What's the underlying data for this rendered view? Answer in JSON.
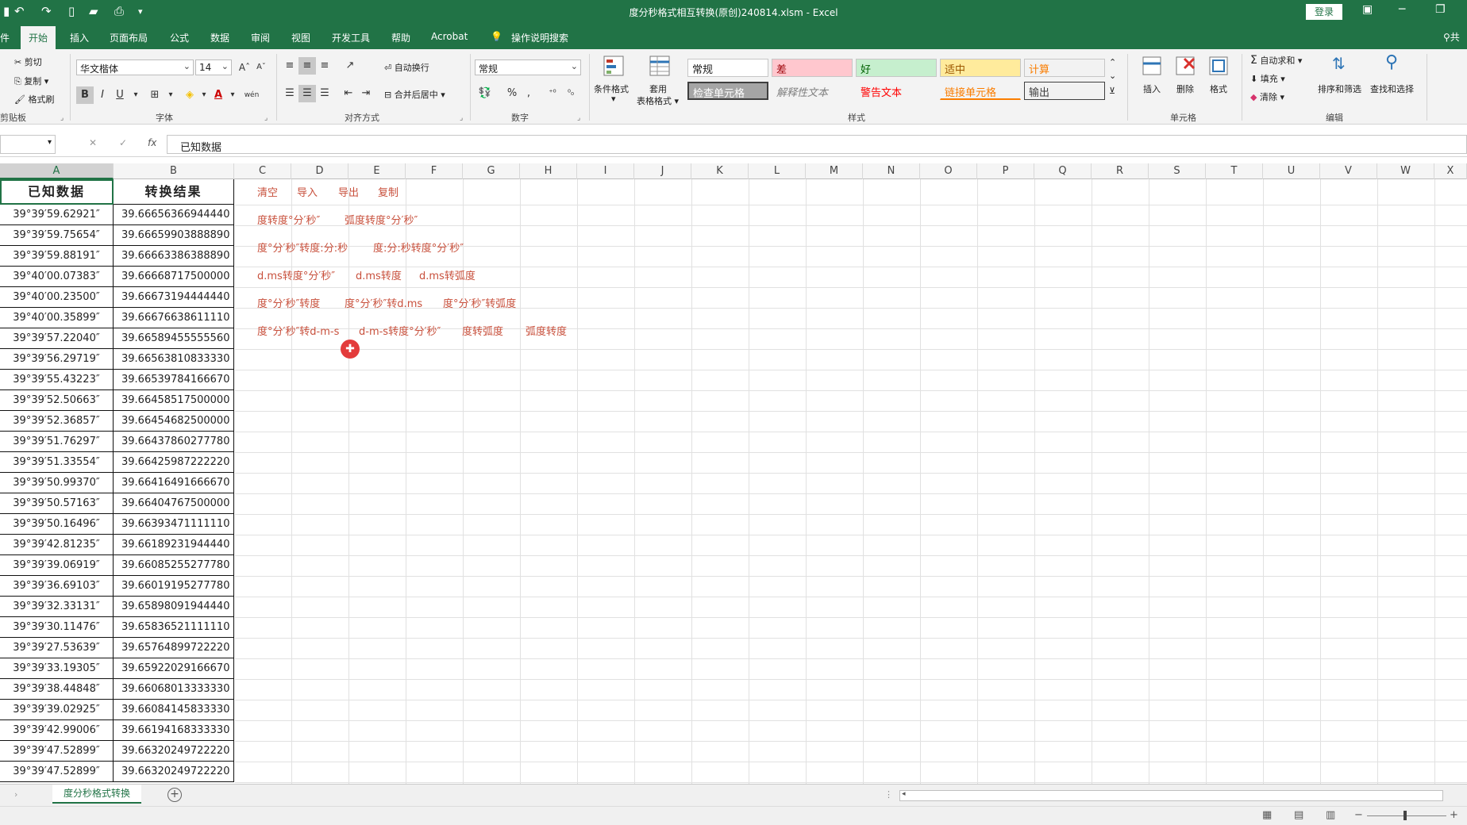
{
  "title_bar": {
    "title": "度分秒格式相互转换(原创)240814.xlsm  -  Excel",
    "login_label": "登录",
    "icons": [
      "undo-icon",
      "redo-icon",
      "new-file-icon",
      "open-folder-icon",
      "print-preview-icon",
      "customize-qat-icon"
    ]
  },
  "tabs": [
    {
      "label": "件"
    },
    {
      "label": "开始"
    },
    {
      "label": "插入"
    },
    {
      "label": "页面布局"
    },
    {
      "label": "公式"
    },
    {
      "label": "数据"
    },
    {
      "label": "审阅"
    },
    {
      "label": "视图"
    },
    {
      "label": "开发工具"
    },
    {
      "label": "帮助"
    },
    {
      "label": "Acrobat"
    },
    {
      "label": "操作说明搜索"
    }
  ],
  "share_label": "共",
  "ribbon": {
    "clipboard": {
      "cut": "剪切",
      "copy": "复制",
      "format_painter": "格式刷",
      "group": "剪贴板"
    },
    "font": {
      "name": "华文楷体",
      "size": "14",
      "bold": "B",
      "italic": "I",
      "underline": "U",
      "grow": "A",
      "shrink": "A",
      "font_color": "A",
      "phonetic": "wén",
      "group": "字体"
    },
    "alignment": {
      "wrap": "自动换行",
      "merge": "合并后居中",
      "group": "对齐方式"
    },
    "number": {
      "format": "常规",
      "percent": "%",
      "comma": ",",
      "group": "数字"
    },
    "styles": {
      "conditional": "条件格式",
      "table_format_1": "套用",
      "table_format_2": "表格格式",
      "cells": [
        {
          "label": "常规",
          "bg": "#ffffff",
          "fg": "#222222"
        },
        {
          "label": "差",
          "bg": "#ffc7ce",
          "fg": "#9c0006"
        },
        {
          "label": "好",
          "bg": "#c6efce",
          "fg": "#006100"
        },
        {
          "label": "适中",
          "bg": "#ffeb9c",
          "fg": "#9c5700"
        },
        {
          "label": "计算",
          "bg": "#f2f2f2",
          "fg": "#fa7d00"
        },
        {
          "label": "检查单元格",
          "bg": "#a5a5a5",
          "fg": "#ffffff"
        },
        {
          "label": "解释性文本",
          "bg": "#f3f3f3",
          "fg": "#7f7f7f"
        },
        {
          "label": "警告文本",
          "bg": "#f3f3f3",
          "fg": "#ff0000"
        },
        {
          "label": "链接单元格",
          "bg": "#f3f3f3",
          "fg": "#fa7d00"
        },
        {
          "label": "输出",
          "bg": "#f2f2f2",
          "fg": "#3f3f3f"
        }
      ],
      "group": "样式"
    },
    "cells_group": {
      "insert": "插入",
      "delete": "删除",
      "format": "格式",
      "group": "单元格"
    },
    "editing": {
      "autosum": "自动求和",
      "fill": "填充",
      "clear": "清除",
      "sort": "排序和筛选",
      "find": "查找和选择",
      "group": "编辑"
    }
  },
  "formula_bar": {
    "fx": "fx",
    "value": "已知数据"
  },
  "columns": [
    "A",
    "B",
    "C",
    "D",
    "E",
    "F",
    "G",
    "H",
    "I",
    "J",
    "K",
    "L",
    "M",
    "N",
    "O",
    "P",
    "Q",
    "R",
    "S",
    "T",
    "U",
    "V",
    "W",
    "X"
  ],
  "sheet": {
    "header_a": "已知数据",
    "header_b": "转换结果",
    "rows": [
      {
        "a": "39°39′59.62921″",
        "b": "39.66656366944440"
      },
      {
        "a": "39°39′59.75654″",
        "b": "39.66659903888890"
      },
      {
        "a": "39°39′59.88191″",
        "b": "39.66663386388890"
      },
      {
        "a": "39°40′00.07383″",
        "b": "39.66668717500000"
      },
      {
        "a": "39°40′00.23500″",
        "b": "39.66673194444440"
      },
      {
        "a": "39°40′00.35899″",
        "b": "39.66676638611110"
      },
      {
        "a": "39°39′57.22040″",
        "b": "39.66589455555560"
      },
      {
        "a": "39°39′56.29719″",
        "b": "39.66563810833330"
      },
      {
        "a": "39°39′55.43223″",
        "b": "39.66539784166670"
      },
      {
        "a": "39°39′52.50663″",
        "b": "39.66458517500000"
      },
      {
        "a": "39°39′52.36857″",
        "b": "39.66454682500000"
      },
      {
        "a": "39°39′51.76297″",
        "b": "39.66437860277780"
      },
      {
        "a": "39°39′51.33554″",
        "b": "39.66425987222220"
      },
      {
        "a": "39°39′50.99370″",
        "b": "39.66416491666670"
      },
      {
        "a": "39°39′50.57163″",
        "b": "39.66404767500000"
      },
      {
        "a": "39°39′50.16496″",
        "b": "39.66393471111110"
      },
      {
        "a": "39°39′42.81235″",
        "b": "39.66189231944440"
      },
      {
        "a": "39°39′39.06919″",
        "b": "39.66085255277780"
      },
      {
        "a": "39°39′36.69103″",
        "b": "39.66019195277780"
      },
      {
        "a": "39°39′32.33131″",
        "b": "39.65898091944440"
      },
      {
        "a": "39°39′30.11476″",
        "b": "39.65836521111110"
      },
      {
        "a": "39°39′27.53639″",
        "b": "39.65764899722220"
      },
      {
        "a": "39°39′33.19305″",
        "b": "39.65922029166670"
      },
      {
        "a": "39°39′38.44848″",
        "b": "39.66068013333330"
      },
      {
        "a": "39°39′39.02925″",
        "b": "39.66084145833330"
      },
      {
        "a": "39°39′42.99006″",
        "b": "39.66194168333330"
      },
      {
        "a": "39°39′47.52899″",
        "b": "39.66320249722220"
      },
      {
        "a": "39°39′47.52899″",
        "b": "39.66320249722220"
      }
    ]
  },
  "macro_buttons": [
    [
      "清空",
      "导入",
      "导出",
      "复制"
    ],
    [
      "度转度°分′秒″",
      "弧度转度°分′秒″"
    ],
    [
      "度°分′秒″转度:分:秒",
      "度:分:秒转度°分′秒″"
    ],
    [
      "d.ms转度°分′秒″",
      "d.ms转度",
      "d.ms转弧度"
    ],
    [
      "度°分′秒″转度",
      "度°分′秒″转d.ms",
      "度°分′秒″转弧度"
    ],
    [
      "度°分′秒″转d-m-s",
      "d-m-s转度°分′秒″",
      "度转弧度",
      "弧度转度"
    ]
  ],
  "sheet_tab": {
    "label": "度分秒格式转换"
  },
  "status_bar": {
    "zoom_minus": "−",
    "zoom_plus": "+"
  },
  "colors": {
    "accent": "#217346",
    "macro_text": "#c8503c"
  }
}
